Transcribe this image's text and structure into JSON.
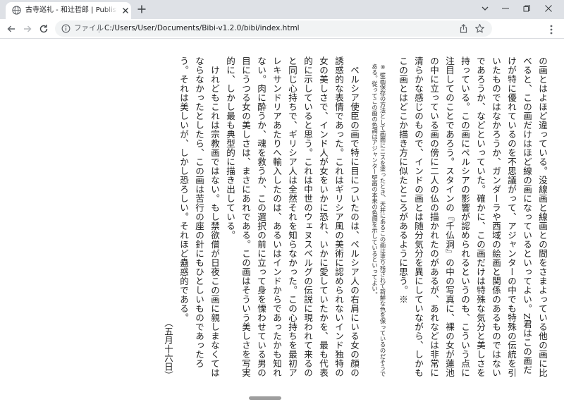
{
  "browser": {
    "tab": {
      "title": "古寺巡礼 - 和辻哲郎 | Published with Bibi"
    },
    "address": {
      "scheme": "ファイル",
      "url": "C:/Users/User/Documents/Bibi-v1.2.0/bibi/index.html"
    }
  },
  "book": {
    "paragraphs": [
      {
        "text": "の画とはよほど違っている。没線画と線画との間をさまよっている他の画に比べると、この画だけはほど線の画になっているといってよい。Z君はこの画だけが特に優れているのを不思議がって、アジャンターの中でも特殊の伝統を引いたものではなかろうか、ガンダーラや西域の絵画と関係のあるものではないであろうか、などといっていた。確かに、この画だけは特殊な気分と美しさを持っている。この画にペルシアの影響が認められるというのも、こういう点に注目してのことであろう。スタインの『千仏洞』の中の写真に、裸の女が蓮池の中に立っている画の傍に二人の仏の描かれたのがあるが、あれなどは非常に清らかな感じのもので、インドの画とは随分気分を異にしていながら、しかもこの画とはどこか描き方に似たところがあるように思う。※",
        "indent": false
      },
      {
        "text": "※ 壁画保存の方法として画面にニスを塗ったとき、天井にあるこの画は塗り残されて新鮮な色を保っているのだそうである。従ってこの画の色調はアジャンター壁画の本来の色調を示しているといってよい。",
        "type": "note"
      },
      {
        "text": "ペルシア使臣の画で特に目についたのは、ペルシア人の右肩にいる女の顔の誘惑的な表情であった。これはギリシア風の美術に認められないインド独特の女の美しさで、インド人が女をいかに恐れ、いかに愛していたかを、最も代表的に示していると思う。これは中世のウェヌスベルグの伝説に現われて来るのと同じ心持ちで、ギリシア人は全然それを知らなかった。この心持ちを最初アレキサンドリアあたりへ輸入したのは、あるいはインドからであったかも知れない。肉に酔うか、魂を救うか、この選択の前に立って身を慄わせている男の目にうつる女の美しさは、まさにあれである。この画はそういう美しさを写実的に、しかし最も典型的に描き出している。",
        "indent": true
      },
      {
        "text": "けれどもこれは宗教画ではない。もし禁欲僧が日夜この画に親しまなくてはならなかったとしたら、この画は苦行の座の針にもひとしいものであったろう。それは美しいが、しかし恐ろしい。それほど蠱惑的である。",
        "indent": true
      },
      {
        "text": "（五月十六日）",
        "type": "date"
      }
    ]
  },
  "colors": {
    "tabstrip": "#dee1e6",
    "omnibox": "#f1f3f4",
    "text": "#1f1f1f",
    "slider": "#9e9e9e"
  }
}
